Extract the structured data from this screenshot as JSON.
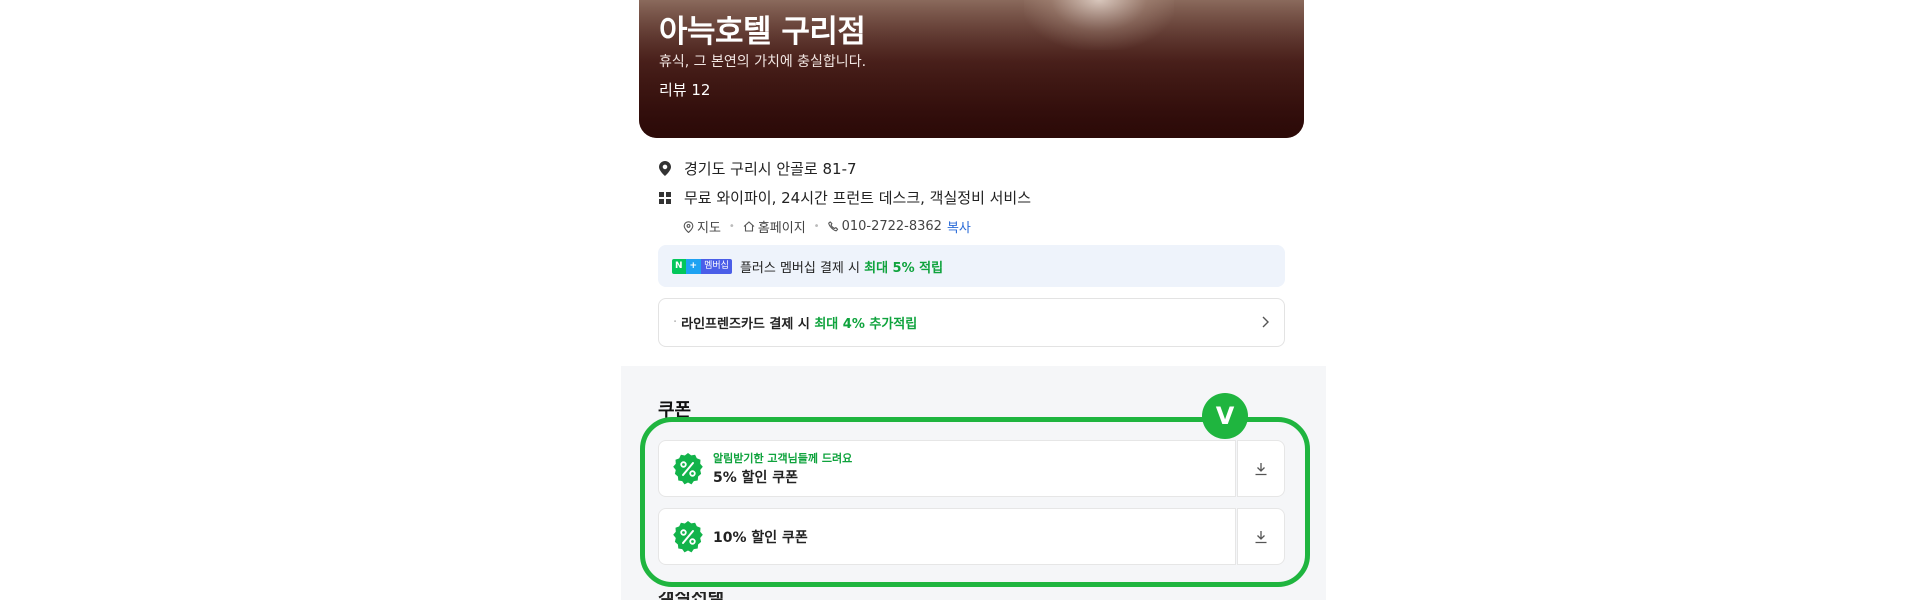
{
  "hero": {
    "title": "아늑호텔 구리점",
    "subtitle": "휴식, 그 본연의 가치에 충실합니다.",
    "review": "리뷰 12"
  },
  "info": {
    "address": "경기도 구리시 안골로 81-7",
    "amenities": "무료 와이파이, 24시간 프런트 데스크, 객실정비 서비스"
  },
  "links": {
    "map": "지도",
    "homepage": "홈페이지",
    "phone": "010-2722-8362",
    "copy": "복사"
  },
  "membership": {
    "badge_n": "N",
    "badge_plus": "+",
    "badge_label": "멤버십",
    "text": "플러스 멤버십 결제 시 ",
    "highlight": "최대 5% 적립"
  },
  "card_promo": {
    "text": "라인프렌즈카드 결제 시 ",
    "highlight": "최대 4% 추가적립"
  },
  "coupons": {
    "section_title": "쿠폰",
    "items": [
      {
        "tag": "알림받기한 고객님들께 드려요",
        "name": "5% 할인 쿠폰"
      },
      {
        "tag": "",
        "name": "10% 할인 쿠폰"
      }
    ]
  },
  "annotation": {
    "badge": "V"
  },
  "next_section": {
    "title": "객실선택"
  },
  "colors": {
    "accent_green": "#1fb53f",
    "text_green": "#0fa33d",
    "link_blue": "#2a6bd8"
  }
}
